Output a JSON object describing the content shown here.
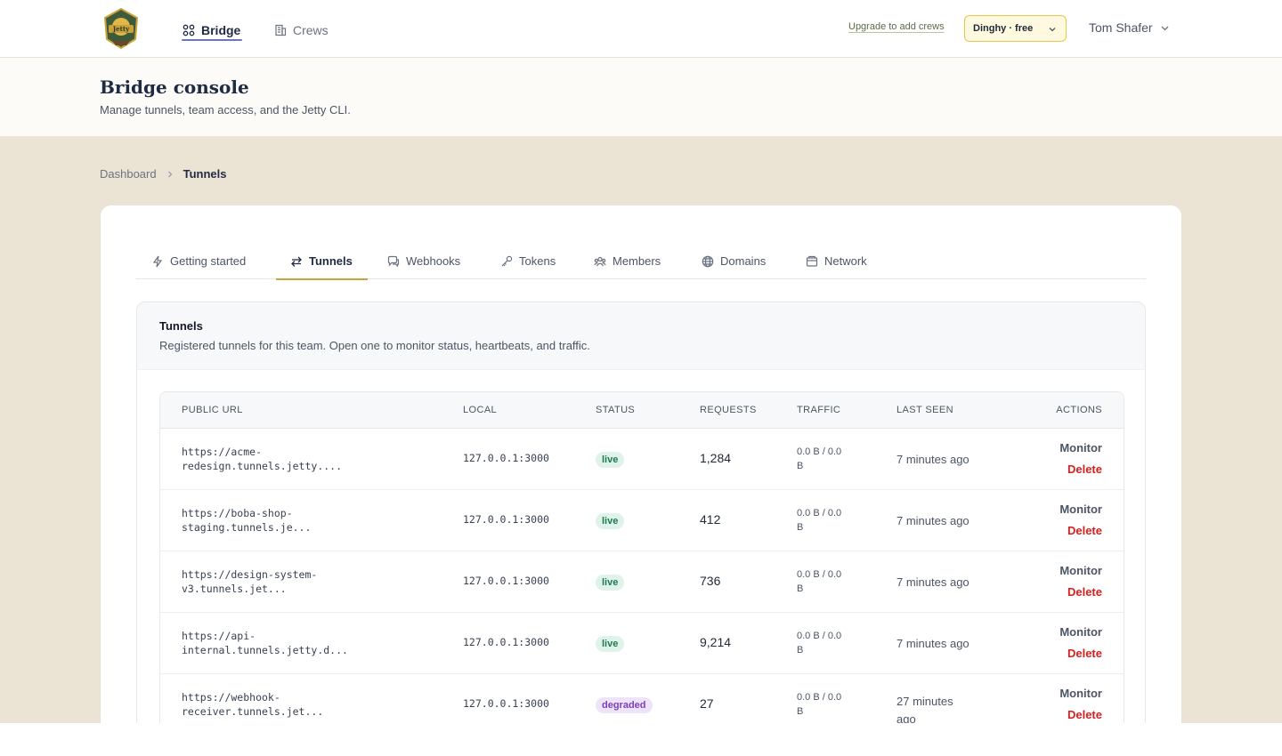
{
  "nav": {
    "logo_text": "Jetty",
    "links": [
      {
        "label": "Bridge",
        "icon": "grid-icon",
        "active": true
      },
      {
        "label": "Crews",
        "icon": "building-icon",
        "active": false
      }
    ],
    "upgrade_label": "Upgrade to add crews",
    "plan_label": "Dinghy · free",
    "user_name": "Tom Shafer",
    "colors": {
      "plan_border": "#e8c64a",
      "plan_bg": "#fff9df",
      "active_underline": "#6b78b8"
    }
  },
  "header": {
    "title": "Bridge console",
    "subtitle": "Manage tunnels, team access, and the Jetty CLI."
  },
  "breadcrumb": {
    "items": [
      "Dashboard",
      "Tunnels"
    ]
  },
  "tabs": [
    {
      "label": "Getting started",
      "icon": "bolt-icon"
    },
    {
      "label": "Tunnels",
      "icon": "arrows-swap-icon",
      "active": true
    },
    {
      "label": "Webhooks",
      "icon": "chat-bubbles-icon"
    },
    {
      "label": "Tokens",
      "icon": "key-icon"
    },
    {
      "label": "Members",
      "icon": "users-icon"
    },
    {
      "label": "Domains",
      "icon": "globe-icon"
    },
    {
      "label": "Network",
      "icon": "inbox-icon"
    }
  ],
  "panel": {
    "title": "Tunnels",
    "description": "Registered tunnels for this team. Open one to monitor status, heartbeats, and traffic."
  },
  "table": {
    "columns": [
      "PUBLIC URL",
      "LOCAL",
      "STATUS",
      "REQUESTS",
      "TRAFFIC",
      "LAST SEEN",
      "ACTIONS"
    ],
    "rows": [
      {
        "url_line1": "https://acme-",
        "url_line2": "redesign.tunnels.jetty....",
        "local": "127.0.0.1:3000",
        "status": "live",
        "requests": "1,284",
        "traffic_line1": "0.0 B / 0.0",
        "traffic_line2": "B",
        "last_seen": "7 minutes ago",
        "monitor": "Monitor",
        "delete": "Delete"
      },
      {
        "url_line1": "https://boba-shop-",
        "url_line2": "staging.tunnels.je...",
        "local": "127.0.0.1:3000",
        "status": "live",
        "requests": "412",
        "traffic_line1": "0.0 B / 0.0",
        "traffic_line2": "B",
        "last_seen": "7 minutes ago",
        "monitor": "Monitor",
        "delete": "Delete"
      },
      {
        "url_line1": "https://design-system-",
        "url_line2": "v3.tunnels.jet...",
        "local": "127.0.0.1:3000",
        "status": "live",
        "requests": "736",
        "traffic_line1": "0.0 B / 0.0",
        "traffic_line2": "B",
        "last_seen": "7 minutes ago",
        "monitor": "Monitor",
        "delete": "Delete"
      },
      {
        "url_line1": "https://api-",
        "url_line2": "internal.tunnels.jetty.d...",
        "local": "127.0.0.1:3000",
        "status": "live",
        "requests": "9,214",
        "traffic_line1": "0.0 B / 0.0",
        "traffic_line2": "B",
        "last_seen": "7 minutes ago",
        "monitor": "Monitor",
        "delete": "Delete"
      },
      {
        "url_line1": "https://webhook-",
        "url_line2": "receiver.tunnels.jet...",
        "local": "127.0.0.1:3000",
        "status": "degraded",
        "requests": "27",
        "traffic_line1": "0.0 B / 0.0",
        "traffic_line2": "B",
        "last_seen": "27 minutes ago",
        "monitor": "Monitor",
        "delete": "Delete"
      }
    ],
    "status_colors": {
      "live_bg": "#dff3ea",
      "live_text": "#1e7a4f",
      "degraded_bg": "#ede4f9",
      "degraded_text": "#7b3fb8",
      "delete_text": "#d32020"
    }
  }
}
